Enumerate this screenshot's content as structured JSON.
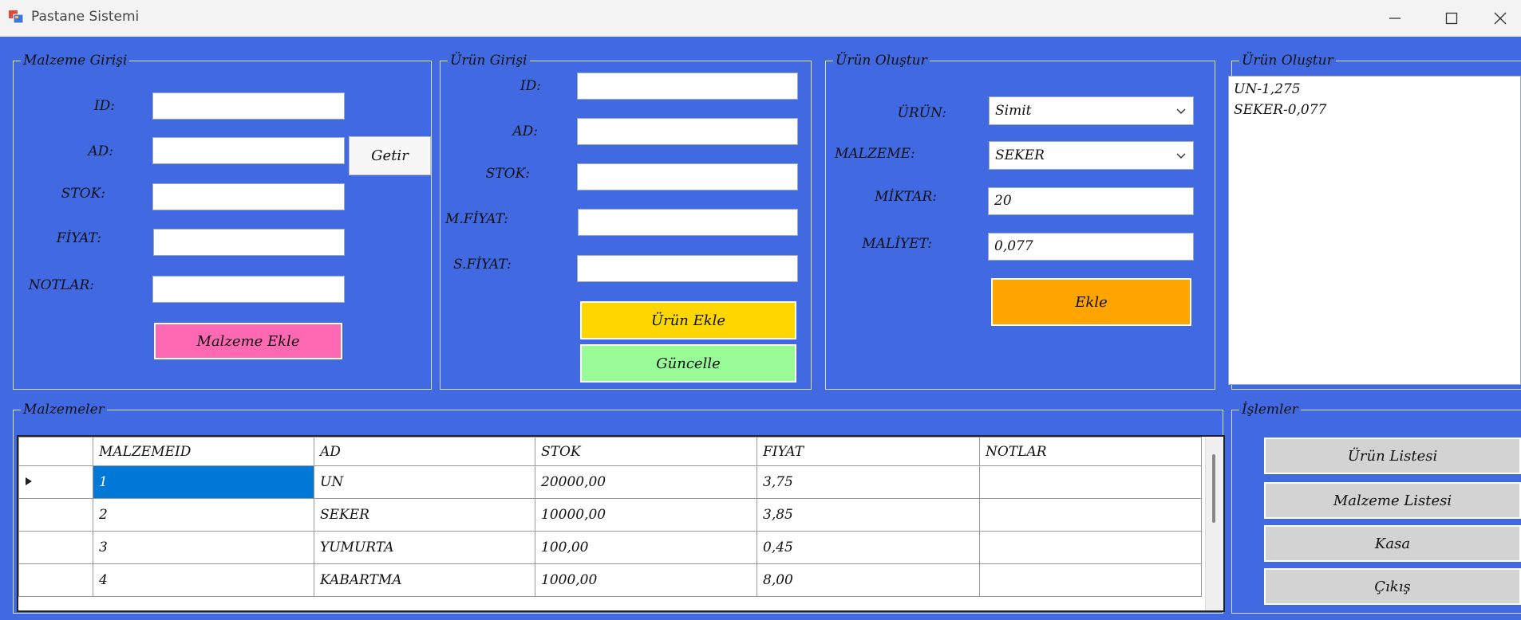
{
  "window": {
    "title": "Pastane Sistemi"
  },
  "malzeme_girisi": {
    "title": "Malzeme Girişi",
    "labels": {
      "id": "ID:",
      "ad": "AD:",
      "stok": "STOK:",
      "fiyat": "FİYAT:",
      "notlar": "NOTLAR:"
    },
    "values": {
      "id": "",
      "ad": "",
      "stok": "",
      "fiyat": "",
      "notlar": ""
    },
    "getir_label": "Getir",
    "ekle_label": "Malzeme Ekle"
  },
  "urun_girisi": {
    "title": "Ürün Girişi",
    "labels": {
      "id": "ID:",
      "ad": "AD:",
      "stok": "STOK:",
      "mfiyat": "M.FİYAT:",
      "sfiyat": "S.FİYAT:"
    },
    "values": {
      "id": "",
      "ad": "",
      "stok": "",
      "mfiyat": "",
      "sfiyat": ""
    },
    "ekle_label": "Ürün Ekle",
    "guncelle_label": "Güncelle"
  },
  "urun_olustur": {
    "title": "Ürün Oluştur",
    "labels": {
      "urun": "ÜRÜN:",
      "malzeme": "MALZEME:",
      "miktar": "MİKTAR:",
      "maliyet": "MALİYET:"
    },
    "values": {
      "urun": "Simit",
      "malzeme": "SEKER",
      "miktar": "20",
      "maliyet": "0,077"
    },
    "ekle_label": "Ekle"
  },
  "urun_olustur_list": {
    "title": "Ürün Oluştur",
    "items": [
      "UN-1,275",
      "SEKER-0,077"
    ]
  },
  "malzemeler": {
    "title": "Malzemeler",
    "columns": [
      "MALZEMEID",
      "AD",
      "STOK",
      "FIYAT",
      "NOTLAR"
    ],
    "rows": [
      [
        "1",
        "UN",
        "20000,00",
        "3,75",
        ""
      ],
      [
        "2",
        "SEKER",
        "10000,00",
        "3,85",
        ""
      ],
      [
        "3",
        "YUMURTA",
        "100,00",
        "0,45",
        ""
      ],
      [
        "4",
        "KABARTMA",
        "1000,00",
        "8,00",
        ""
      ]
    ],
    "selected_row": 0
  },
  "islemler": {
    "title": "İşlemler",
    "buttons": [
      "Ürün Listesi",
      "Malzeme Listesi",
      "Kasa",
      "Çıkış"
    ]
  },
  "colors": {
    "background": "#4169E1",
    "malzeme_ekle": "#FF69B4",
    "urun_ekle": "#FFD700",
    "guncelle": "#98FB98",
    "ekle": "#FFA500",
    "islem_button": "#D3D3D3",
    "selection": "#0078D7"
  }
}
